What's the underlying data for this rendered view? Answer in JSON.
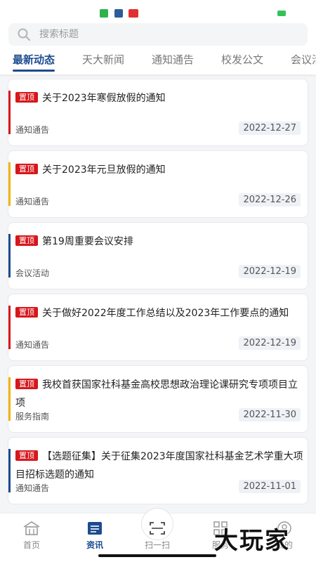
{
  "search": {
    "placeholder": "搜索标题"
  },
  "tabs": [
    {
      "label": "最新动态",
      "active": true
    },
    {
      "label": "天大新闻",
      "active": false
    },
    {
      "label": "通知通告",
      "active": false
    },
    {
      "label": "校发公文",
      "active": false
    },
    {
      "label": "会议活",
      "active": false
    }
  ],
  "items": [
    {
      "tag": "置顶",
      "title": "关于2023年寒假放假的通知",
      "category": "通知通告",
      "date": "2022-12-27",
      "accent": "#d7171b"
    },
    {
      "tag": "置顶",
      "title": "关于2023年元旦放假的通知",
      "category": "通知通告",
      "date": "2022-12-26",
      "accent": "#f2b400"
    },
    {
      "tag": "置顶",
      "title": "第19周重要会议安排",
      "category": "会议活动",
      "date": "2022-12-19",
      "accent": "#1c4c8f"
    },
    {
      "tag": "置顶",
      "title": "关于做好2022年度工作总结以及2023年工作要点的通知",
      "category": "通知通告",
      "date": "2022-12-19",
      "accent": "#d7171b"
    },
    {
      "tag": "置顶",
      "title": "我校首获国家社科基金高校思想政治理论课研究专项项目立项",
      "category": "服务指南",
      "date": "2022-11-30",
      "accent": "#f2b400"
    },
    {
      "tag": "置顶",
      "title": "【选题征集】关于征集2023年度国家社科基金艺术学重大项目招标选题的通知",
      "category": "通知通告",
      "date": "2022-11-01",
      "accent": "#1c4c8f"
    }
  ],
  "nav": [
    {
      "label": "首页",
      "icon": "home-icon"
    },
    {
      "label": "资讯",
      "icon": "news-icon"
    },
    {
      "label": "扫一扫",
      "icon": "scan-icon"
    },
    {
      "label": "服务",
      "icon": "grid-icon"
    },
    {
      "label": "我的",
      "icon": "user-icon"
    }
  ],
  "watermark": "大玩家",
  "colors": {
    "accent": "#1c4c8f",
    "tag": "#d7171b"
  }
}
